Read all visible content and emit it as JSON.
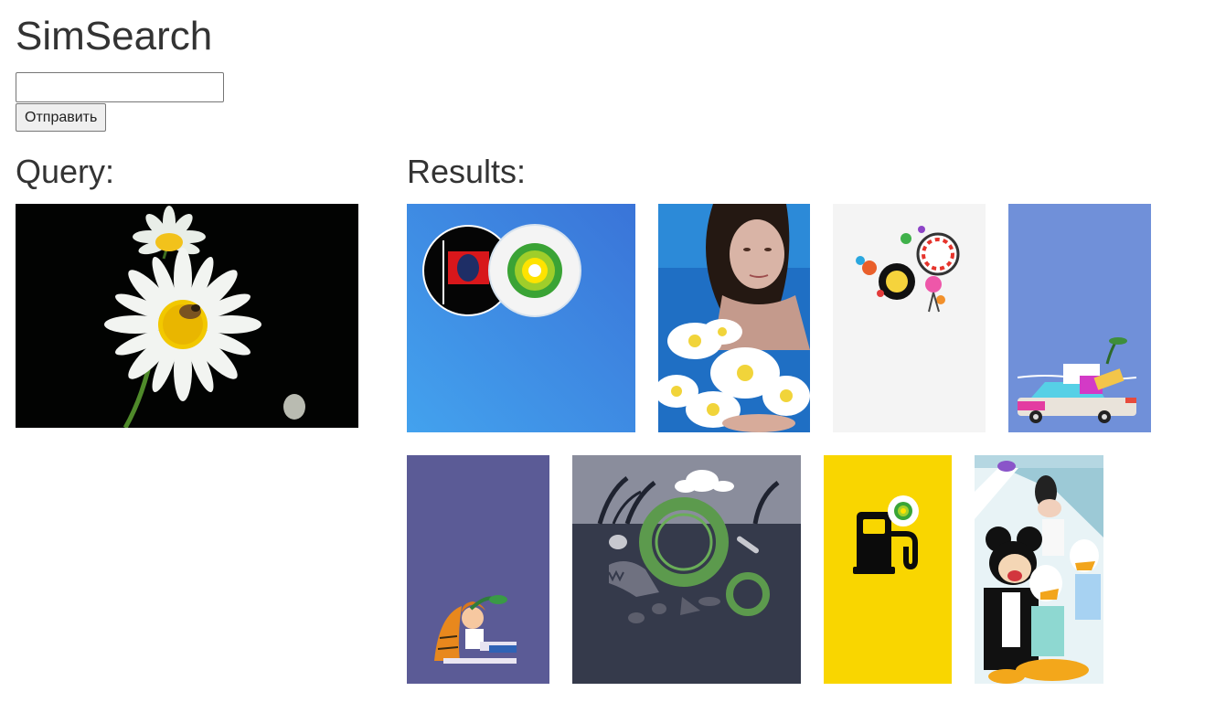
{
  "app": {
    "title": "SimSearch"
  },
  "search": {
    "value": "",
    "submit_label": "Отправить"
  },
  "query_section": {
    "heading": "Query:"
  },
  "results_section": {
    "heading": "Results:"
  },
  "query_image": {
    "subject": "daisy-with-bee-on-black"
  },
  "results": [
    {
      "subject": "red-flag-and-bp-logo-circles",
      "background_color": "#3c8ee3"
    },
    {
      "subject": "girl-underwater-with-daisies",
      "background_color": "#1f6fc4"
    },
    {
      "subject": "colorful-festival-wheels",
      "background_color": "#f4f4f4"
    },
    {
      "subject": "car-with-luggage-illustration",
      "background_color": "#7090d9"
    },
    {
      "subject": "child-reading-with-tiger",
      "background_color": "#5b5b96"
    },
    {
      "subject": "tyres-and-fossils-underground",
      "background_color": "#353a4b"
    },
    {
      "subject": "fuel-pump-bp-icon",
      "background_color": "#f9d600"
    },
    {
      "subject": "mickey-donald-goofy-daisy",
      "background_color": "#e8f3f6"
    }
  ],
  "colors": {
    "text": "#333333",
    "button_bg": "#efefef",
    "border": "#767676"
  }
}
